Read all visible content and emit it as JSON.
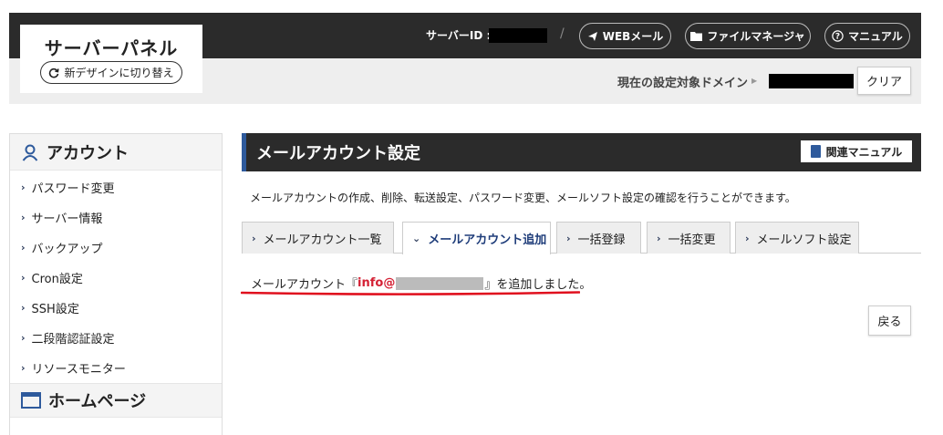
{
  "header": {
    "panel_title": "サーバーパネル",
    "new_design_label": "新デザインに切り替え",
    "server_id_label": "サーバーID :",
    "separator": "/",
    "webmail_label": "WEBメール",
    "file_manager_label": "ファイルマネージャ",
    "manual_label": "マニュアル",
    "domain_label": "現在の設定対象ドメイン",
    "clear_label": "クリア"
  },
  "sidebar": {
    "account_heading": "アカウント",
    "items": [
      {
        "label": "パスワード変更"
      },
      {
        "label": "サーバー情報"
      },
      {
        "label": "バックアップ"
      },
      {
        "label": "Cron設定"
      },
      {
        "label": "SSH設定"
      },
      {
        "label": "二段階認証設定"
      },
      {
        "label": "リソースモニター"
      }
    ],
    "homepage_heading": "ホームページ"
  },
  "main": {
    "title": "メールアカウント設定",
    "related_manual_label": "関連マニュアル",
    "description": "メールアカウントの作成、削除、転送設定、パスワード変更、メールソフト設定の確認を行うことができます。",
    "tabs": [
      {
        "label": "メールアカウント一覧",
        "active": false
      },
      {
        "label": "メールアカウント追加",
        "active": true
      },
      {
        "label": "一括登録",
        "active": false
      },
      {
        "label": "一括変更",
        "active": false
      },
      {
        "label": "メールソフト設定",
        "active": false
      }
    ],
    "result_prefix": "メールアカウント『",
    "result_email": "info@",
    "result_suffix": "』を追加しました。",
    "back_label": "戻る"
  },
  "colors": {
    "header_bg": "#2b2b2b",
    "accent_blue": "#2e5a9c",
    "highlight_red": "#d42034",
    "annotation_red": "#e0101e"
  }
}
